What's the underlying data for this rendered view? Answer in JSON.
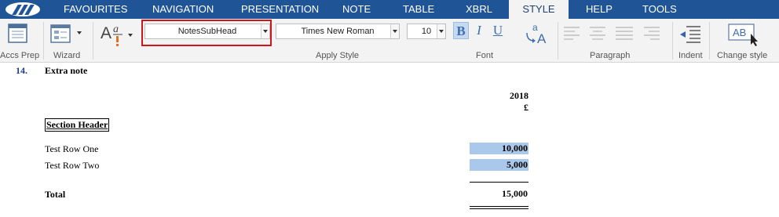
{
  "tabs": [
    {
      "label": "FAVOURITES"
    },
    {
      "label": "NAVIGATION"
    },
    {
      "label": "PRESENTATION"
    },
    {
      "label": "NOTE"
    },
    {
      "label": "TABLE"
    },
    {
      "label": "XBRL"
    },
    {
      "label": "STYLE",
      "active": true
    },
    {
      "label": "HELP"
    },
    {
      "label": "TOOLS"
    }
  ],
  "ribbon": {
    "accs_prep_label": "Accs Prep",
    "wizard_label": "Wizard",
    "apply_style_label": "Apply Style",
    "style_value": "NotesSubHead",
    "font_value": "Times New Roman",
    "size_value": "10",
    "bold_label": "B",
    "italic_label": "I",
    "underline_label": "U",
    "font_label": "Font",
    "paragraph_label": "Paragraph",
    "indent_label": "Indent",
    "change_style_label": "Change style",
    "change_style_icon_text": "AB",
    "case_icon_text_small": "a",
    "case_icon_text_big": "A"
  },
  "colors": {
    "tab_bar": "#1f5597",
    "highlight_border": "#d0161b",
    "selected_cell": "#a9c8ea",
    "note_number": "#1f3f8f"
  },
  "document": {
    "note_number": "14.",
    "note_title": "Extra note",
    "year": "2018",
    "currency": "£",
    "section_header": "Section Header",
    "rows": [
      {
        "label": "Test Row One",
        "value": "10,000"
      },
      {
        "label": "Test Row Two",
        "value": "5,000"
      }
    ],
    "total_label": "Total",
    "total_value": "15,000"
  }
}
